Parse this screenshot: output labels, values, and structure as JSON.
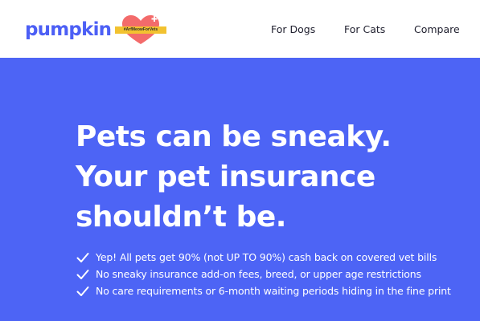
{
  "brand": {
    "logo_text": "pumpkin",
    "badge_text": "#ArfMeowForVets",
    "accent_color": "#4d64f5",
    "badge_heart_color": "#f36b6b",
    "badge_label_color": "#f2c230"
  },
  "nav": {
    "items": [
      {
        "label": "For Dogs"
      },
      {
        "label": "For Cats"
      },
      {
        "label": "Compare"
      }
    ]
  },
  "hero": {
    "headline_lines": [
      "Pets can be sneaky.",
      "Your pet insurance",
      "shouldn’t be."
    ],
    "benefits": [
      {
        "icon": "checkmark-icon",
        "text": "Yep! All pets get 90% (not UP TO 90%) cash back on covered vet bills"
      },
      {
        "icon": "checkmark-icon",
        "text": "No sneaky insurance add-on fees, breed, or upper age restrictions"
      },
      {
        "icon": "checkmark-icon",
        "text": "No care requirements or 6-month waiting periods hiding in the fine print"
      }
    ]
  }
}
